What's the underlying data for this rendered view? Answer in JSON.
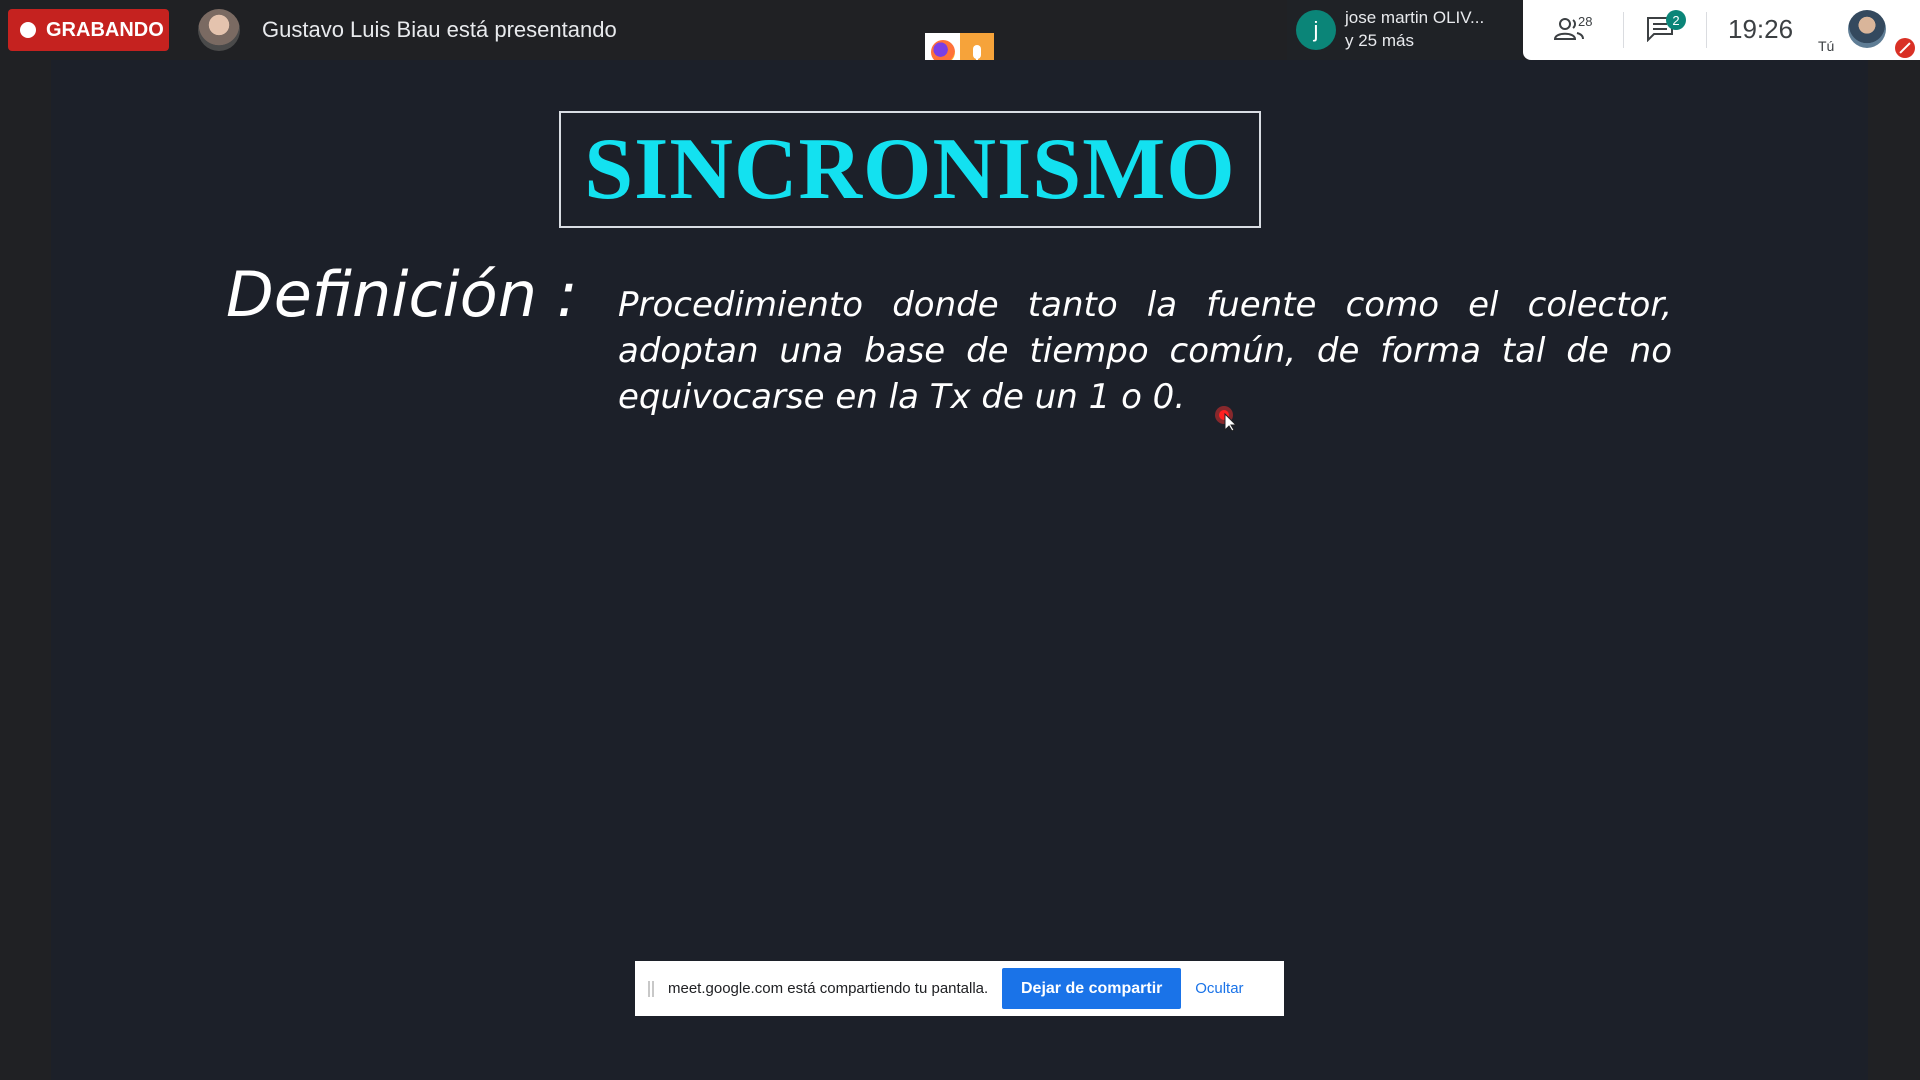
{
  "topbar": {
    "recording_label": "GRABANDO",
    "presenter_text": "Gustavo Luis Biau está presentando"
  },
  "speaker": {
    "initial": "j",
    "name": "jose martin OLIV...",
    "more": "y 25 más"
  },
  "controls": {
    "people_count": "28",
    "chat_unread": "2",
    "clock": "19:26",
    "self_label": "Tú"
  },
  "slide": {
    "title": "SINCRONISMO",
    "definition_label": "Definición  :",
    "definition_text": "Procedimiento donde tanto la fuente como el colector, adoptan una base de tiempo común, de forma tal de no equivocarse en la Tx de un 1 o 0."
  },
  "share_bar": {
    "message": "meet.google.com está compartiendo tu pantalla.",
    "stop_label": "Dejar de compartir",
    "hide_label": "Ocultar"
  },
  "colors": {
    "recording": "#c5221f",
    "title": "#13e1f0",
    "accent_blue": "#1a73e8",
    "avatar_teal": "#0b8578"
  }
}
